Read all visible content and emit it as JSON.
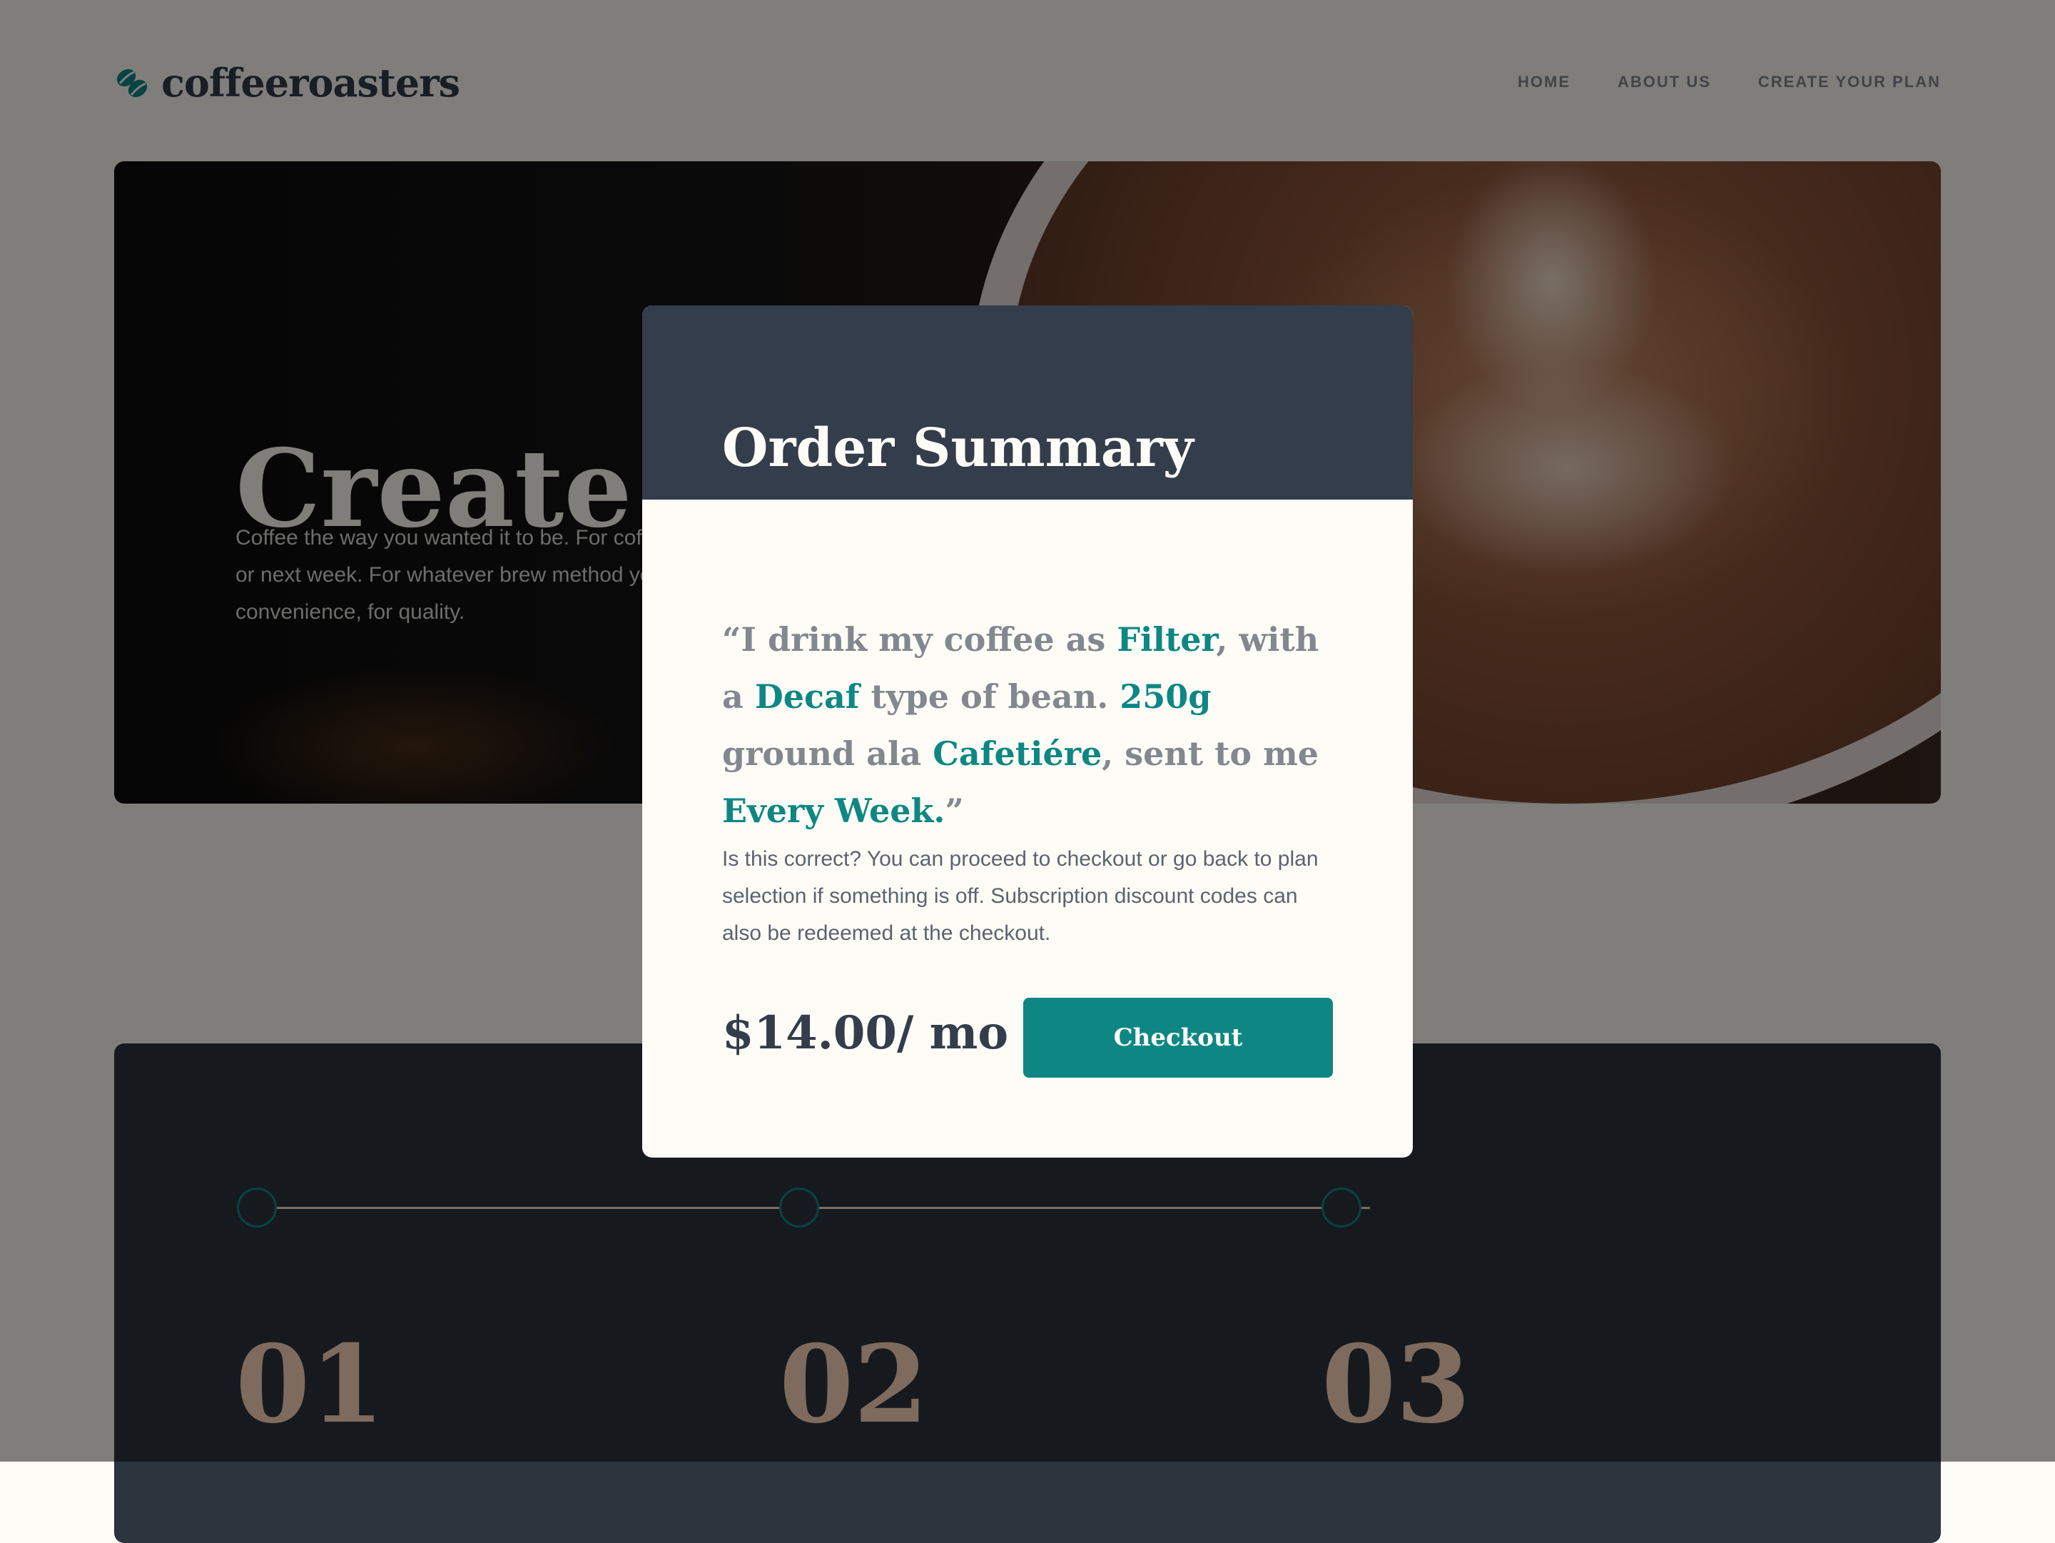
{
  "header": {
    "logo_text": "coffeeroasters",
    "nav": [
      "HOME",
      "ABOUT US",
      "CREATE YOUR PLAN"
    ]
  },
  "hero": {
    "title": "Create plan",
    "text": "Coffee the way you wanted it to be. For coffee delivered tomorrow, or next week. For whatever brew method you use. For choice, for convenience, for quality."
  },
  "steps": [
    "01",
    "02",
    "03"
  ],
  "modal": {
    "title": "Order Summary",
    "summary": {
      "open_quote": "“",
      "p1": "I drink my coffee as ",
      "preference": "Filter",
      "p2": ", with a ",
      "bean_type": "Decaf",
      "p3": " type of bean. ",
      "quantity": "250g",
      "p4": " ground ala ",
      "grind": "Cafetiére",
      "p5": ", sent to me ",
      "frequency": "Every Week",
      "p6": ".",
      "close_quote": "”"
    },
    "description": "Is this correct? You can proceed to checkout or go back to plan selection if something is off. Subscription discount codes can also be redeemed at the checkout.",
    "price": "$14.00/ mo",
    "checkout_label": "Checkout"
  },
  "colors": {
    "accent": "#0e8784",
    "dark_grey_blue": "#333d4b",
    "cream": "#fefcf7",
    "grey": "#83888f",
    "apricot": "#fdd6ba"
  }
}
